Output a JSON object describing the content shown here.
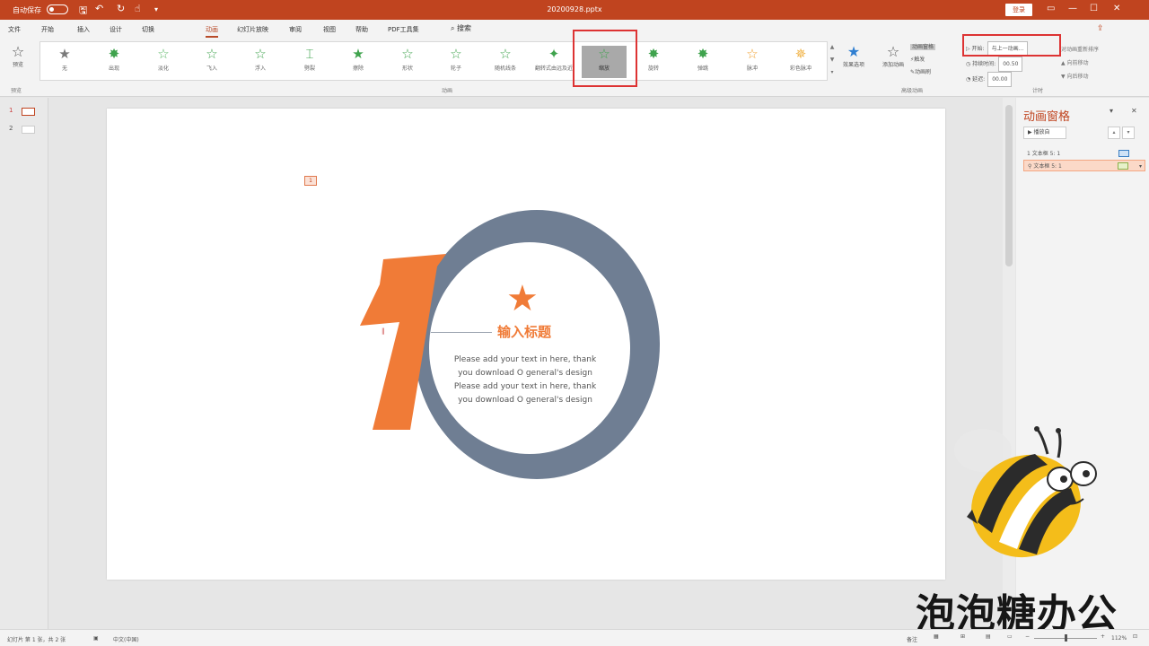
{
  "titlebar": {
    "autosave_label": "自动保存",
    "doc_title": "20200928.pptx",
    "login_label": "登录",
    "quick_access": [
      "save-icon",
      "undo-icon",
      "redo-icon",
      "customize-icon"
    ]
  },
  "tabs": {
    "items": [
      "文件",
      "开始",
      "插入",
      "设计",
      "切换",
      "动画",
      "幻灯片放映",
      "审阅",
      "视图",
      "帮助",
      "PDF工具集"
    ],
    "active": "动画",
    "search_label": "搜索"
  },
  "ribbon": {
    "preview_label": "预览",
    "preview_group": "预览",
    "animations": [
      "无",
      "出现",
      "淡化",
      "飞入",
      "浮入",
      "劈裂",
      "擦除",
      "形状",
      "轮子",
      "随机线条",
      "翻转式由远及近",
      "缩放",
      "旋转",
      "弹跳",
      "脉冲",
      "彩色脉冲"
    ],
    "selected_animation": "缩放",
    "animation_group": "动画",
    "effect_options_label": "效果选项",
    "add_animation_label": "添加动画",
    "animation_pane_label": "动画窗格",
    "trigger_label": "触发",
    "animation_painter_label": "动画刷",
    "advanced_group": "高级动画",
    "start_label": "开始:",
    "start_value": "与上一动画...",
    "duration_label": "持续时间:",
    "duration_value": "00.50",
    "delay_label": "延迟:",
    "delay_value": "00.00",
    "reorder_label": "对动画重新排序",
    "move_earlier": "向前移动",
    "move_later": "向后移动",
    "timing_group": "计时"
  },
  "slides": {
    "numbers": [
      "1",
      "2"
    ]
  },
  "slide": {
    "marker": "1",
    "big_number": "1",
    "title": "输入标题",
    "body_lines": [
      "Please add your text in here, thank",
      "you download O general's design",
      "Please add your text in here, thank",
      "you download O general's design"
    ],
    "accent_color": "#f07b37",
    "ring_color": "#6f7e93"
  },
  "anim_pane": {
    "title": "动画窗格",
    "play_label": "播放自",
    "items": [
      {
        "order": "1",
        "label": "文本框 5: 1"
      },
      {
        "order": "",
        "label": "文本框 5: 1"
      }
    ]
  },
  "statusbar": {
    "slide_info": "幻灯片 第 1 张，共 2 张",
    "language": "中文(中国)",
    "notes": "备注",
    "zoom": "112%"
  },
  "watermark": "泡泡糖办公"
}
